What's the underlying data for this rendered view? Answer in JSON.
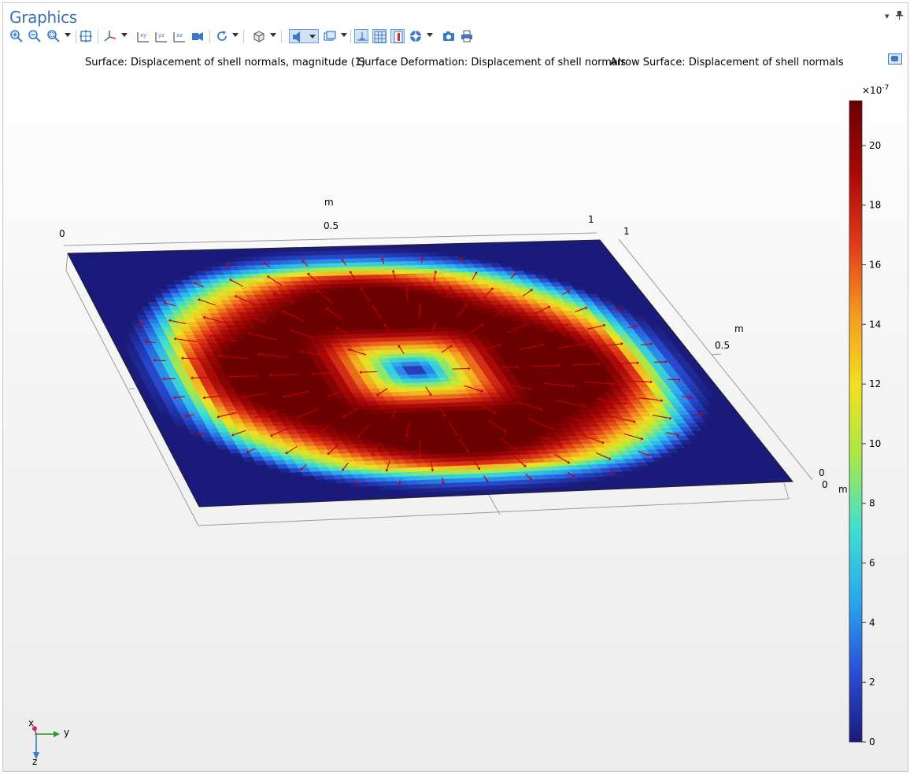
{
  "window": {
    "title": "Graphics"
  },
  "toolbar": {
    "buttons": [
      "zoom-in",
      "zoom-out",
      "zoom-box",
      "zoom-extents",
      "go-to-default-view",
      "view-xy",
      "view-yz",
      "view-xz",
      "go-to-view",
      "rotate",
      "select-render",
      "transparency",
      "scene-light",
      "show-grid",
      "show-axis",
      "color-table",
      "image-snapshot",
      "camera",
      "print"
    ]
  },
  "plot": {
    "titles": [
      "Surface: Displacement of shell normals, magnitude (1)",
      "Surface Deformation: Displacement of shell normals",
      "Arrow Surface: Displacement of shell normals"
    ],
    "axes": {
      "x_label": "m",
      "x_ticks": [
        "0",
        "0.5",
        "1"
      ],
      "y_label": "m",
      "y_ticks": [
        "1",
        "0.5",
        "0"
      ],
      "z_label": "m",
      "z_ticks": [
        "0"
      ]
    }
  },
  "colorbar": {
    "exponent": "×10",
    "exponent_power": "-7",
    "ticks": [
      "20",
      "18",
      "16",
      "14",
      "12",
      "10",
      "8",
      "6",
      "4",
      "2",
      "0"
    ],
    "range": [
      0,
      21.5
    ],
    "colors": [
      "#1a1a7a",
      "#2a4fd8",
      "#2aa8f0",
      "#3ee0d0",
      "#a8e84a",
      "#f0e020",
      "#f49a20",
      "#e03a18",
      "#a80808",
      "#6a0000"
    ]
  },
  "triad": {
    "x": "x",
    "y": "y",
    "z": "z"
  },
  "colors": {
    "accent": "#3c6eb4",
    "arrow": "#c00000"
  }
}
